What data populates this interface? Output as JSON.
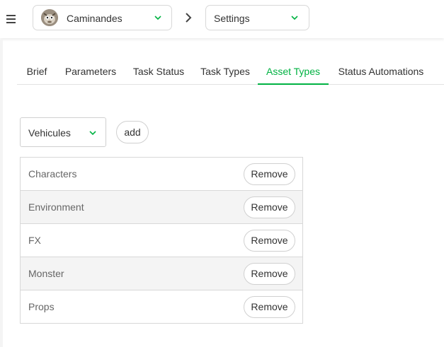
{
  "header": {
    "production": "Caminandes",
    "section": "Settings"
  },
  "tabs": [
    {
      "label": "Brief"
    },
    {
      "label": "Parameters"
    },
    {
      "label": "Task Status"
    },
    {
      "label": "Task Types"
    },
    {
      "label": "Asset Types",
      "active": true
    },
    {
      "label": "Status Automations"
    }
  ],
  "asset_type_select": {
    "value": "Vehicules"
  },
  "add_label": "add",
  "asset_types": [
    {
      "name": "Characters",
      "action": "Remove"
    },
    {
      "name": "Environment",
      "action": "Remove"
    },
    {
      "name": "FX",
      "action": "Remove"
    },
    {
      "name": "Monster",
      "action": "Remove"
    },
    {
      "name": "Props",
      "action": "Remove"
    }
  ],
  "colors": {
    "accent": "#00b242",
    "alt_row": "#f4f4f4",
    "border": "#d8d8d8"
  },
  "icons": {
    "menu": "hamburger-menu-icon",
    "chevron": "chevron-down-icon",
    "separator": "chevron-right-icon"
  }
}
